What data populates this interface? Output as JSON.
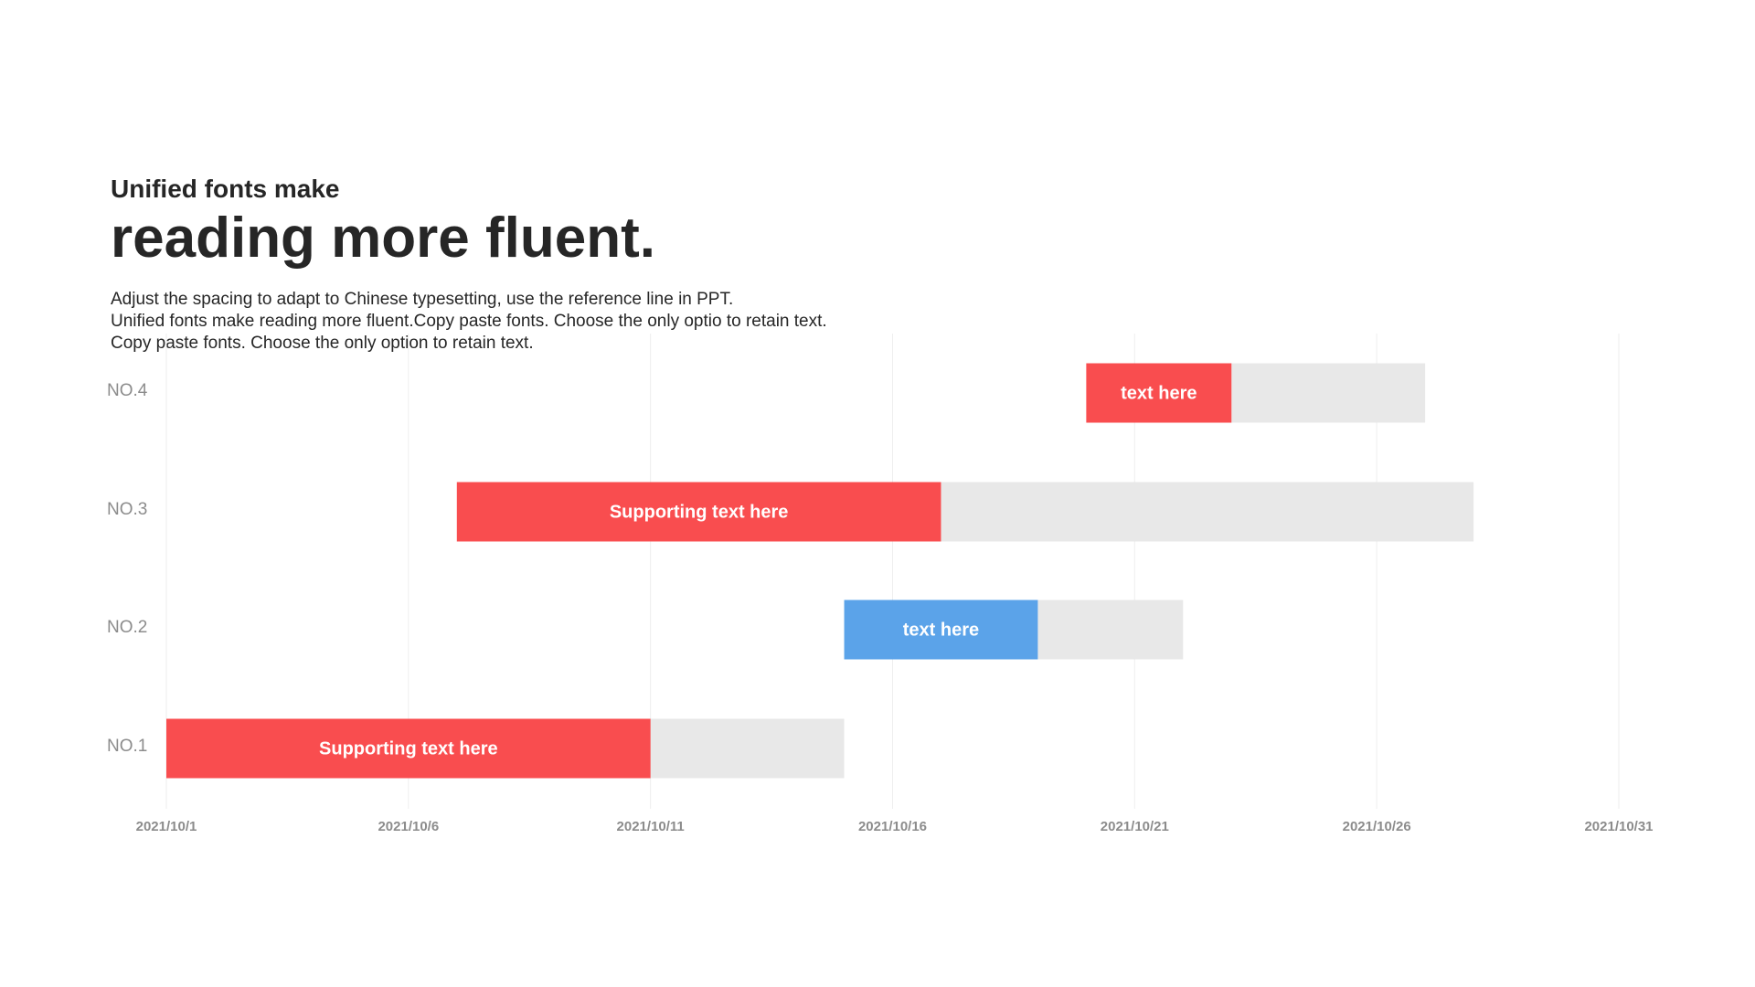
{
  "header": {
    "subtitle": "Unified fonts make",
    "title": "reading more fluent.",
    "description": [
      "Adjust the spacing to adapt to Chinese typesetting, use the reference line in PPT.",
      "Unified fonts make reading more fluent.Copy paste fonts. Choose the only optio to retain text.",
      "Copy paste  fonts. Choose the only option to retain text."
    ]
  },
  "chart_data": {
    "type": "bar",
    "orientation": "horizontal-gantt",
    "title": "",
    "xlabel": "",
    "ylabel": "",
    "x_axis": {
      "type": "date",
      "range": [
        "2021/10/1",
        "2021/10/31"
      ],
      "ticks": [
        "2021/10/1",
        "2021/10/6",
        "2021/10/11",
        "2021/10/16",
        "2021/10/21",
        "2021/10/26",
        "2021/10/31"
      ]
    },
    "grid": "vertical",
    "categories": [
      "NO.4",
      "NO.3",
      "NO.2",
      "NO.1"
    ],
    "tasks": [
      {
        "category": "NO.4",
        "start": "2021/10/20",
        "progress_end": "2021/10/23",
        "end": "2021/10/27",
        "label": "text here",
        "color": "#f94d4f"
      },
      {
        "category": "NO.3",
        "start": "2021/10/7",
        "progress_end": "2021/10/17",
        "end": "2021/10/28",
        "label": "Supporting text here",
        "color": "#f94d4f"
      },
      {
        "category": "NO.2",
        "start": "2021/10/15",
        "progress_end": "2021/10/19",
        "end": "2021/10/22",
        "label": "text here",
        "color": "#5ba3e9"
      },
      {
        "category": "NO.1",
        "start": "2021/10/1",
        "progress_end": "2021/10/11",
        "end": "2021/10/15",
        "label": "Supporting text here",
        "color": "#f94d4f"
      }
    ],
    "colors": {
      "remaining": "#e8e8e8",
      "grid": "#eeeeee",
      "axis_text": "#8c8c8c"
    }
  }
}
